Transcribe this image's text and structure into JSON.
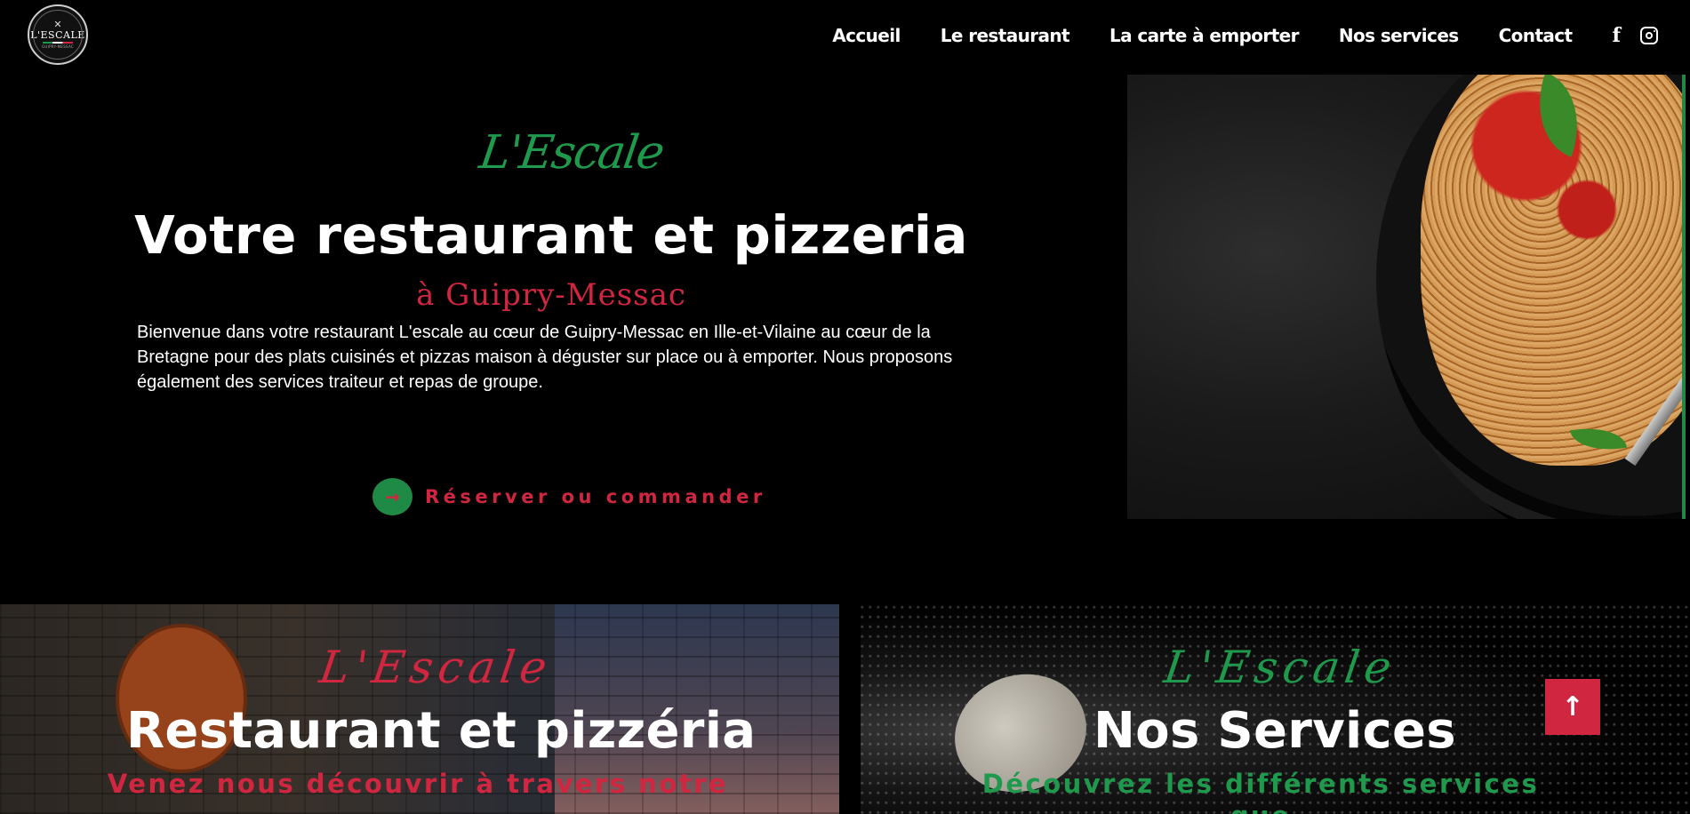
{
  "header": {
    "logo": {
      "name": "L'ESCALE",
      "sub": "GUIPRY-MESSAC"
    },
    "nav": [
      "Accueil",
      "Le restaurant",
      "La carte à emporter",
      "Nos services",
      "Contact"
    ],
    "social": [
      "facebook-icon",
      "instagram-icon"
    ]
  },
  "hero": {
    "script": "L'Escale",
    "title": "Votre restaurant et pizzeria",
    "subtitle": "à Guipry-Messac",
    "text": "Bienvenue dans votre restaurant L'escale au cœur de Guipry-Messac en Ille-et-Vilaine au cœur de la Bretagne pour des plats cuisinés et pizzas maison à déguster sur place ou à emporter. Nous proposons également des services traiteur et repas de groupe.",
    "cta": "Réserver ou commander",
    "cta_icon": "→"
  },
  "cards": {
    "left": {
      "script": "L'Escale",
      "title": "Restaurant et pizzéria",
      "subtitle": "Venez nous découvrir à travers notre"
    },
    "right": {
      "script": "L'Escale",
      "title": "Nos Services",
      "subtitle": "Découvrez les différents services que"
    }
  },
  "scroll_top_icon": "↑",
  "colors": {
    "accent_green": "#1f9a4d",
    "accent_red": "#d0263f",
    "background": "#000000"
  }
}
